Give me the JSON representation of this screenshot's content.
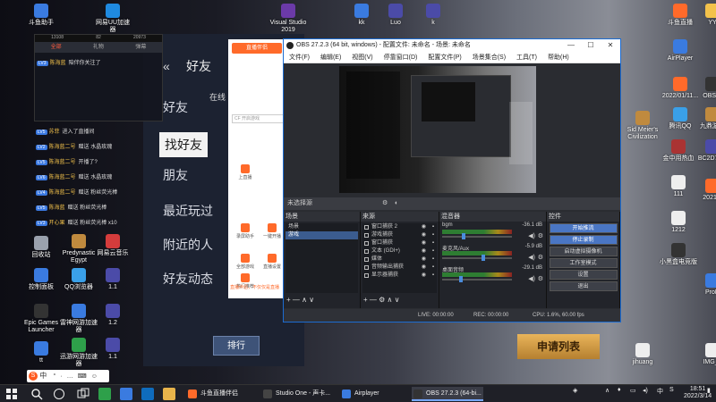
{
  "desktop_icons_left": [
    {
      "label": "斗鱼助手",
      "color": "#3a7be0"
    },
    {
      "label": "回收站",
      "color": "#9aa1ad"
    },
    {
      "label": "控制面板",
      "color": "#3a7be0"
    },
    {
      "label": "Epic Games Launcher",
      "color": "#333333"
    },
    {
      "label": "tt",
      "color": "#3a7be0"
    }
  ],
  "desktop_icons_mid": [
    {
      "label": "Predynastic Egypt",
      "color": "#c08a3e"
    },
    {
      "label": "QQ浏览器",
      "color": "#3aa0e8"
    },
    {
      "label": "雷神网游加速器",
      "color": "#3a7be0"
    },
    {
      "label": "迅游网游加速器",
      "color": "#2ea04a"
    }
  ],
  "desktop_icons_col3": [
    {
      "label": "网易UU加速器",
      "color": "#1f8ae0"
    },
    {
      "label": "网易云音乐",
      "color": "#d53c3c"
    },
    {
      "label": "1.1",
      "color": "#4b4ba8"
    },
    {
      "label": "1.2",
      "color": "#4b4ba8"
    },
    {
      "label": "1.1",
      "color": "#4b4ba8"
    }
  ],
  "desktop_icons_top": [
    {
      "label": "Visual Studio 2019",
      "color": "#6b3aa8"
    },
    {
      "label": "kk",
      "color": "#3a7be0"
    },
    {
      "label": "Luo",
      "color": "#4b4ba8"
    },
    {
      "label": "k",
      "color": "#4b4ba8"
    }
  ],
  "desktop_icons_right": [
    {
      "label": "斗鱼直播",
      "color": "#ff6a2a"
    },
    {
      "label": "AirPlayer",
      "color": "#3a7be0"
    },
    {
      "label": "2022/01/11...",
      "color": "#ff6a2a"
    },
    {
      "label": "OBS S",
      "color": "#333333"
    },
    {
      "label": "腾讯QQ",
      "color": "#3aa0e8"
    },
    {
      "label": "九鼎游戏",
      "color": "#c08a3e"
    },
    {
      "label": "Sid Meier's Civilization",
      "color": "#c08a3e"
    },
    {
      "label": "金中用热血",
      "color": "#aa3333"
    },
    {
      "label": "BC2D79...",
      "color": "#4b4ba8"
    },
    {
      "label": "111",
      "color": "#eeeeee"
    },
    {
      "label": "1212",
      "color": "#eeeeee"
    },
    {
      "label": "小黑盒电竞版",
      "color": "#333333"
    },
    {
      "label": "YY",
      "color": "#f3c24b"
    },
    {
      "label": "2021.0",
      "color": "#ff6a2a"
    },
    {
      "label": "ProD",
      "color": "#3a7be0"
    },
    {
      "label": "jihuang",
      "color": "#eeeeee"
    },
    {
      "label": "IMG_0",
      "color": "#eeeeee"
    }
  ],
  "stream_overlay": {
    "tabs": [
      "全部",
      "礼物",
      "弹幕"
    ],
    "active_tab": 0,
    "stats": [
      "13108",
      "82",
      "20973"
    ],
    "chat": [
      {
        "badge": "LV3",
        "name": "陈海蓝",
        "text": "陪伴你关注了"
      },
      {
        "badge": "LV5",
        "name": "苏菲",
        "text": "进入了直播间"
      },
      {
        "badge": "LV2",
        "name": "陈海蓝二号",
        "text": "赠送 水晶玫瑰"
      },
      {
        "badge": "LV5",
        "name": "陈海蓝二号",
        "text": "开播了?"
      },
      {
        "badge": "LV6",
        "name": "陈海蓝二号",
        "text": "赠送 水晶玫瑰"
      },
      {
        "badge": "LV4",
        "name": "陈海蓝二号",
        "text": "赠送 粉丝荧光棒"
      },
      {
        "badge": "LV5",
        "name": "陈海蓝",
        "text": "赠送 粉丝荧光棒"
      },
      {
        "badge": "LV3",
        "name": "开心果",
        "text": "赠送 粉丝荧光棒 x10"
      }
    ]
  },
  "game_menu": [
    {
      "label": "好友",
      "active": false
    },
    {
      "label": "找好友",
      "active": true
    },
    {
      "label": "朋友",
      "active": false
    },
    {
      "label": "最近玩过",
      "active": false
    },
    {
      "label": "附近的人",
      "active": false
    },
    {
      "label": "好友动态",
      "active": false
    }
  ],
  "game_header": "好友",
  "game_header_suffix": "在线",
  "assistant": {
    "logo": "直播伴侣",
    "search_placeholder": "CF 开启游戏",
    "items": [
      "上直播",
      "录屏助手",
      "一键开播",
      "全部游戏",
      "直播设置",
      "热门推荐"
    ],
    "tip": "直播伴侣，不仅仅是直播"
  },
  "obs": {
    "title": "OBS 27.2.3 (64 bit, windows) - 配置文件: 未命名 - 场景: 未命名",
    "menu": [
      "文件(F)",
      "编辑(E)",
      "视图(V)",
      "停靠窗口(D)",
      "配置文件(P)",
      "场景集合(S)",
      "工具(T)",
      "帮助(H)"
    ],
    "toolbar_label": "未选择源",
    "docks": {
      "scenes": {
        "title": "场景",
        "items": [
          "场景",
          "游戏"
        ],
        "selected": 1
      },
      "sources": {
        "title": "来源",
        "items": [
          "窗口捕获 2",
          "游戏捕获",
          "窗口捕获",
          "文本 (GDI+)",
          "媒体",
          "音频输出捕获",
          "显示器捕获"
        ]
      },
      "mixer": {
        "title": "混音器",
        "rows": [
          {
            "name": "bgm",
            "db": "-36.1 dB",
            "level": 0.3
          },
          {
            "name": "麦克风/Aux",
            "db": "-5.9 dB",
            "level": 0.6
          },
          {
            "name": "桌面音频",
            "db": "-29.1 dB",
            "level": 0.25
          }
        ]
      },
      "controls": {
        "title": "控件",
        "buttons": [
          "开始推流",
          "停止录制",
          "启动虚拟摄像机",
          "工作室模式",
          "设置",
          "退出"
        ]
      }
    },
    "status": {
      "live": "LIVE: 00:00:00",
      "rec": "REC: 00:00:00",
      "cpu": "CPU: 1.6%, 60.00 fps"
    }
  },
  "game_bottom": {
    "rank_label": "排行",
    "apply_label": "申请列表"
  },
  "ime": {
    "label": "中",
    "extras": [
      "°",
      "·",
      "…",
      "⌨",
      "☺"
    ]
  },
  "taskbar": {
    "apps": [
      {
        "label": "斗鱼直播伴侣",
        "color": "#ff6a2a",
        "active": false
      },
      {
        "label": "Studio One - 声卡...",
        "color": "#444444",
        "active": false
      },
      {
        "label": "Airplayer",
        "color": "#3a7be0",
        "active": false
      },
      {
        "label": "OBS 27.2.3 (64-bi...",
        "color": "#333333",
        "active": true
      }
    ],
    "time": "18:51",
    "date": "2022/3/14",
    "ime_indicator": "中"
  }
}
